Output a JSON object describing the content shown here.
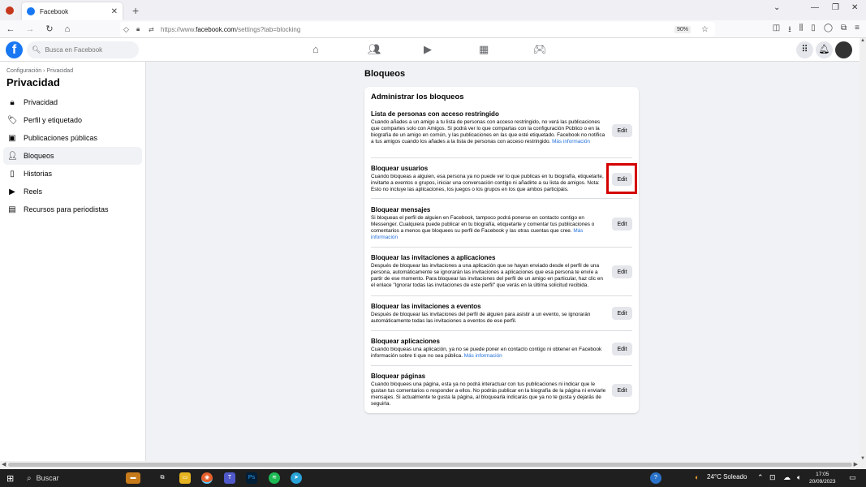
{
  "browser": {
    "tab_title": "Facebook",
    "tab_close": "✕",
    "new_tab": "+",
    "url_prefix": "https://www.",
    "url_domain": "facebook.com",
    "url_path": "/settings?tab=blocking",
    "zoom": "90%"
  },
  "fb": {
    "logo": "f",
    "search_placeholder": "Busca en Facebook"
  },
  "sidebar": {
    "breadcrumb": "Configuración › Privacidad",
    "title": "Privacidad",
    "items": [
      {
        "label": "Privacidad",
        "icon": "lock-icon"
      },
      {
        "label": "Perfil y etiquetado",
        "icon": "tag-icon"
      },
      {
        "label": "Publicaciones públicas",
        "icon": "public-posts-icon"
      },
      {
        "label": "Bloqueos",
        "icon": "block-user-icon"
      },
      {
        "label": "Historias",
        "icon": "stories-icon"
      },
      {
        "label": "Reels",
        "icon": "reels-icon"
      },
      {
        "label": "Recursos para periodistas",
        "icon": "journalist-icon"
      }
    ]
  },
  "main": {
    "heading": "Bloqueos",
    "card_title": "Administrar los bloqueos",
    "edit_label": "Edit",
    "sections": [
      {
        "title": "Lista de personas con acceso restringido",
        "desc": "Cuando añades a un amigo a tu lista de personas con acceso restringido, no verá las publicaciones que compartes solo con Amigos. Si podrá ver lo que compartas con la configuración Público o en la biografía de un amigo en común, y las publicaciones en las que esté etiquetado. Facebook no notifica a tus amigos cuando los añades a la lista de personas con acceso restringido.",
        "link": "Más información"
      },
      {
        "title": "Bloquear usuarios",
        "desc": "Cuando bloqueas a alguien, esa persona ya no puede ver lo que publicas en tu biografía, etiquetarte, invitarte a eventos o grupos, iniciar una conversación contigo ni añadirte a su lista de amigos. Nota: Esto no incluye las aplicaciones, los juegos o los grupos en los que ambos participáis.",
        "link": ""
      },
      {
        "title": "Bloquear mensajes",
        "desc": "Si bloqueas el perfil de alguien en Facebook, tampoco podrá ponerse en contacto contigo en Messenger. Cualquiera puede publicar en tu biografía, etiquetarte y comentar tus publicaciones o comentarios a menos que bloquees su perfil de Facebook y las otras cuentas que cree.",
        "link": "Más información"
      },
      {
        "title": "Bloquear las invitaciones a aplicaciones",
        "desc": "Después de bloquear las invitaciones a una aplicación que se hayan enviado desde el perfil de una persona, automáticamente se ignorarán las invitaciones a aplicaciones que esa persona te envíe a partir de ese momento. Para bloquear las invitaciones del perfil de un amigo en particular, haz clic en el enlace \"Ignorar todas las invitaciones de este perfil\" que verás en la última solicitud recibida.",
        "link": ""
      },
      {
        "title": "Bloquear las invitaciones a eventos",
        "desc": "Después de bloquear las invitaciones del perfil de alguien para asistir a un evento, se ignorarán automáticamente todas las invitaciones a eventos de ese perfil.",
        "link": ""
      },
      {
        "title": "Bloquear aplicaciones",
        "desc": "Cuando bloqueas una aplicación, ya no se puede poner en contacto contigo ni obtener en Facebook información sobre ti que no sea pública.",
        "link": "Más información"
      },
      {
        "title": "Bloquear páginas",
        "desc": "Cuando bloquees una página, esta ya no podrá interactuar con tus publicaciones ni indicar que le gustan tus comentarios o responder a ellos. No podrás publicar en la biografía de la página ni enviarle mensajes. Si actualmente te gusta la página, al bloquearla indicarás que ya no te gusta y dejarás de seguirla.",
        "link": ""
      }
    ]
  },
  "taskbar": {
    "search": "Buscar",
    "weather": "24°C Soleado",
    "time": "17:05",
    "date": "20/09/2023"
  },
  "colors": {
    "fb_blue": "#1877f2",
    "highlight": "#d40000",
    "link": "#216fdb"
  }
}
